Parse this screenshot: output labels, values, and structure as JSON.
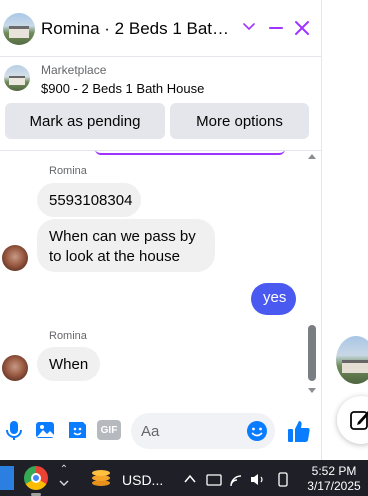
{
  "header": {
    "title": "Romina · 2 Beds 1 Bath Ho…",
    "accent": "#a033ff"
  },
  "listing": {
    "source": "Marketplace",
    "title": "$900 - 2 Beds 1 Bath House",
    "mark_pending_label": "Mark as pending",
    "more_options_label": "More options"
  },
  "messages": [
    {
      "sender": "Romina",
      "text": "5593108304"
    },
    {
      "text": "When can we pass by to look at the house"
    },
    {
      "text": "yes"
    },
    {
      "sender": "Romina",
      "text": "When"
    }
  ],
  "composer": {
    "placeholder": "Aa",
    "gif_label": "GIF"
  },
  "taskbar": {
    "app_label": "USD...",
    "overflow_glyph": "⌃",
    "time": "5:52 PM",
    "date": "3/17/2025"
  },
  "colors": {
    "outgoing_bubble": "#4a5af0",
    "incoming_bubble": "#f0f0f0",
    "messenger_blue": "#0a7cff"
  }
}
